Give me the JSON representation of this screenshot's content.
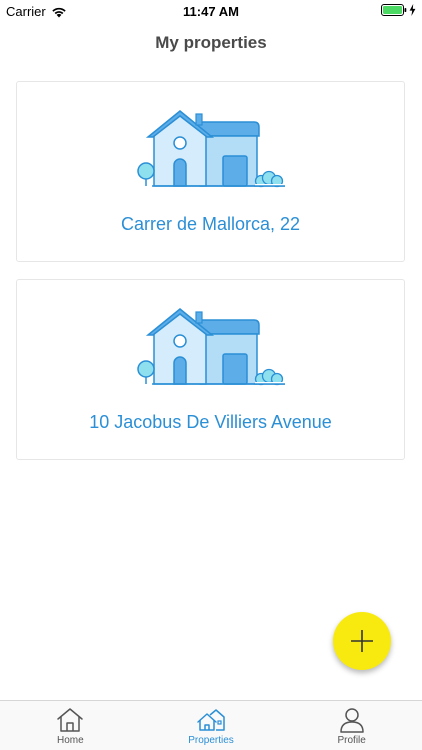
{
  "status_bar": {
    "carrier": "Carrier",
    "time": "11:47 AM",
    "battery_color": "#4cd964"
  },
  "nav": {
    "title": "My properties"
  },
  "properties": [
    {
      "address": "Carrer de Mallorca, 22",
      "icon": "house-icon"
    },
    {
      "address": "10 Jacobus De Villiers Avenue",
      "icon": "house-icon"
    }
  ],
  "fab": {
    "icon": "plus-icon",
    "color": "#f8ea0e"
  },
  "tabs": [
    {
      "label": "Home",
      "icon": "home-icon",
      "active": false
    },
    {
      "label": "Properties",
      "icon": "properties-icon",
      "active": true
    },
    {
      "label": "Profile",
      "icon": "profile-icon",
      "active": false
    }
  ],
  "colors": {
    "accent": "#2b8fd6",
    "inactive": "#555555"
  }
}
